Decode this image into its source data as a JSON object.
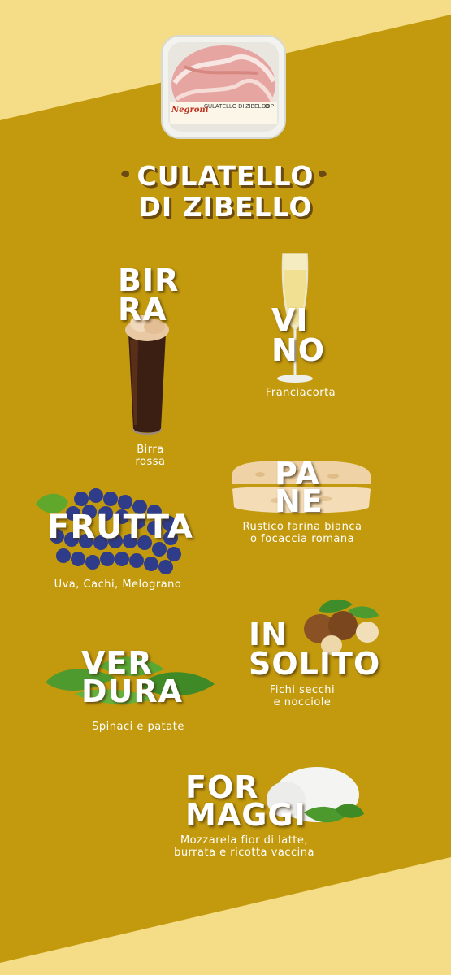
{
  "colors": {
    "background": "#c39a0e",
    "light_band": "#f5dd87",
    "text": "#ffffff"
  },
  "product": {
    "brand": "Negroni",
    "label": "CULATELLO DI ZIBELLO",
    "badge": "DOP"
  },
  "title": {
    "line1": "CULATELLO",
    "line2": "DI ZIBELLO"
  },
  "items": {
    "birra": {
      "word1": "BIR",
      "word2": "RA",
      "caption1": "Birra",
      "caption2": "rossa",
      "icon": "beer-glass"
    },
    "vino": {
      "word1": "VI",
      "word2": "NO",
      "caption1": "Franciacorta",
      "icon": "champagne-glass"
    },
    "pane": {
      "word1": "PA",
      "word2": "NE",
      "caption1": "Rustico farina bianca",
      "caption2": "o focaccia romana",
      "icon": "bread"
    },
    "frutta": {
      "word1": "FRUTTA",
      "caption1": "Uva, Cachi, Melograno",
      "icon": "grapes"
    },
    "insolito": {
      "word1": "IN",
      "word2": "SOLITO",
      "caption1": "Fichi secchi",
      "caption2": "e nocciole",
      "icon": "hazelnuts"
    },
    "verdura": {
      "word1": "VER",
      "word2": "DURA",
      "caption1": "Spinaci e patate",
      "icon": "spinach-leaves"
    },
    "formaggi": {
      "word1": "FOR",
      "word2": "MAGGI",
      "caption1": "Mozzarela fior di latte,",
      "caption2": "burrata e ricotta vaccina",
      "icon": "mozzarella"
    }
  }
}
